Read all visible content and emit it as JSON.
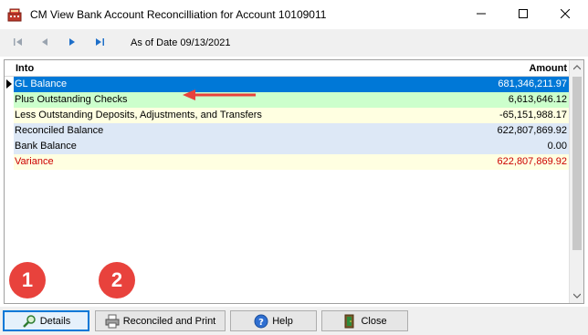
{
  "window": {
    "title": "CM View Bank Account Reconcilliation for Account 10109011",
    "icon": "cash-register-icon"
  },
  "navbar": {
    "as_of": "As of Date 09/13/2021",
    "icons": [
      "first-record-icon",
      "previous-record-icon",
      "next-record-icon",
      "last-record-icon"
    ]
  },
  "grid": {
    "columns": {
      "into": "Into",
      "amount": "Amount"
    },
    "rows": [
      {
        "desc": "GL Balance",
        "amount": "681,346,211.97",
        "bg": "#0078d7",
        "fg": "#ffffff",
        "selected": true
      },
      {
        "desc": "Plus Outstanding Checks",
        "amount": "6,613,646.12",
        "bg": "#ccffcc",
        "fg": "#000000",
        "selected": false
      },
      {
        "desc": "Less Outstanding Deposits, Adjustments, and Transfers",
        "amount": "-65,151,988.17",
        "bg": "#ffffe1",
        "fg": "#000000",
        "selected": false
      },
      {
        "desc": "Reconciled Balance",
        "amount": "622,807,869.92",
        "bg": "#dde8f6",
        "fg": "#000000",
        "selected": false
      },
      {
        "desc": "Bank Balance",
        "amount": "0.00",
        "bg": "#dde8f6",
        "fg": "#000000",
        "selected": false
      },
      {
        "desc": "Variance",
        "amount": "622,807,869.92",
        "bg": "#ffffe1",
        "fg": "#cc0000",
        "selected": false
      }
    ]
  },
  "annotations": {
    "badge_1": "1",
    "badge_2": "2",
    "arrow_color": "#e8423c"
  },
  "buttons": {
    "details": "Details",
    "reconciled_print": "Reconciled and Print",
    "help": "Help",
    "close": "Close"
  }
}
